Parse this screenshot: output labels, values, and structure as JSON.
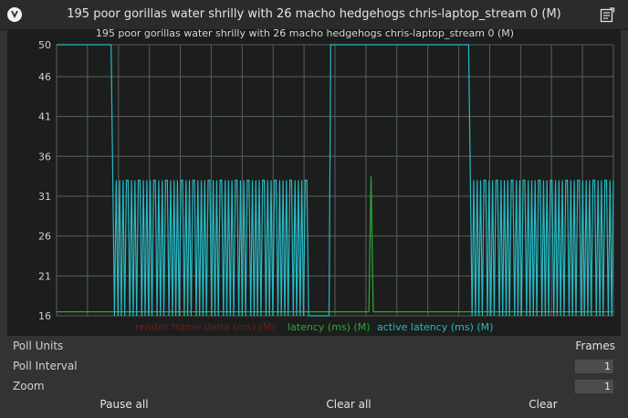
{
  "window": {
    "title": "195 poor gorillas water shrilly with 26 macho hedgehogs chris-laptop_stream 0 (M)"
  },
  "icons": {
    "app": "app-logo-icon",
    "notes": "notes-icon"
  },
  "chart_data": {
    "type": "line",
    "title": "195 poor gorillas water shrilly with 26 macho hedgehogs chris-laptop_stream 0 (M)",
    "ylim": [
      16,
      50
    ],
    "yticks": [
      16,
      21,
      26,
      31,
      36,
      41,
      46,
      50
    ],
    "grid": true,
    "legend_placement": "bottom",
    "series": [
      {
        "name": "render frame delta (ms) (M)",
        "color": "#6e1d1d",
        "values": []
      },
      {
        "name": "latency (ms) (M)",
        "color": "#2fa82f",
        "values": [
          16.5,
          16.5,
          16.5,
          16.5,
          16.5,
          16.5,
          16.5,
          16.5,
          16.5,
          16.5,
          16.5,
          16.5,
          16.5,
          16.5,
          16.5,
          16.5,
          16.5,
          16.5,
          16.5,
          16.5,
          16.5,
          16.5,
          16.5,
          16.5,
          16.5,
          16.5,
          16.5,
          16.5,
          16.5,
          16.5,
          16.5,
          16.5,
          16.5,
          16.5,
          16.5,
          16.5,
          16.5,
          16.5,
          16.5,
          16.5,
          16.5,
          16.5,
          16.5,
          16.5,
          16.5,
          16.5,
          16.5,
          16.5,
          16.5,
          16.5,
          16.5,
          16.5,
          16.5,
          16.5,
          16.5,
          16.5,
          16.5,
          16.5,
          16.5,
          16.5,
          16.5,
          16.5,
          16.5,
          16.5,
          16.5,
          16.5,
          16.5,
          16.5,
          16.5,
          16.5,
          16.5,
          16.5,
          16.5,
          16.5,
          16.5,
          16.5,
          16.5,
          16.5,
          16.5,
          16.5,
          16.5,
          16.5,
          16.5,
          16.5,
          16.5,
          16.5,
          16.5,
          16.5,
          16.5,
          16.5,
          16.5,
          16.5,
          16.5,
          16.5,
          16.5,
          16.5,
          16.5,
          16.5,
          16.5,
          16.5,
          16.5,
          16.5,
          16.5,
          16.5,
          16.5,
          16.5,
          16.5,
          16.5,
          16.5,
          16.5,
          16.5,
          16.5,
          16.5,
          16.5,
          16.5,
          16.5,
          16.5,
          16.5,
          16.5,
          16.5,
          16.5,
          16.5,
          16.5,
          16.5,
          16.5,
          16.5,
          16.5,
          16.5,
          16.5,
          16.5,
          16.5,
          16.5,
          16.5,
          16.5,
          16.5,
          16.5,
          16.5,
          16.5,
          16.5,
          16.5,
          16.5,
          16.5,
          16.5,
          16.5,
          33.5,
          16.5,
          16.5,
          16.5,
          16.5,
          16.5,
          16.5,
          16.5,
          16.5,
          16.5,
          16.5,
          16.5,
          16.5,
          16.5,
          16.5,
          16.5,
          16.5,
          16.5,
          16.5,
          16.5,
          16.5,
          16.5,
          16.5,
          16.5,
          16.5,
          16.5,
          16.5,
          16.5,
          16.5,
          16.5,
          16.5,
          16.5,
          16.5,
          16.5,
          16.5,
          16.5,
          16.5,
          16.5,
          16.5,
          16.5,
          16.5,
          16.5,
          16.5,
          16.5,
          16.5,
          16.5,
          16.5,
          16.5,
          16.5,
          16.5,
          16.5,
          16.5,
          16.5,
          16.5,
          16.5,
          16.5,
          16.5,
          16.5,
          16.5,
          16.5,
          16.5,
          16.5,
          16.5,
          16.5,
          16.5,
          16.5,
          16.5,
          16.5,
          16.5,
          16.5,
          16.5,
          16.5,
          16.5,
          16.5,
          16.5,
          16.5,
          16.5,
          16.5,
          16.5,
          16.5,
          16.5,
          16.5,
          16.5,
          16.5,
          16.5,
          16.5,
          16.5,
          16.5,
          16.5,
          16.5,
          16.5,
          16.5,
          16.5,
          16.5,
          16.5,
          16.5,
          16.5,
          16.5,
          16.5,
          16.5,
          16.5,
          16.5,
          16.5,
          16.5,
          16.5,
          16.5,
          16.5,
          16.5,
          16.5,
          16.5,
          16.5,
          16.5
        ]
      },
      {
        "name": "active latency (ms) (M)",
        "color": "#29b9c4",
        "values": [
          50,
          50,
          50,
          50,
          50,
          50,
          50,
          50,
          50,
          50,
          50,
          50,
          50,
          50,
          50,
          50,
          50,
          50,
          50,
          50,
          50,
          50,
          50,
          50,
          50,
          50,
          50,
          50,
          50,
          50,
          50,
          50,
          50,
          33,
          16,
          33,
          16,
          33,
          16,
          33,
          16,
          33,
          33,
          16,
          33,
          16,
          33,
          16,
          33,
          33,
          16,
          33,
          16,
          33,
          16,
          33,
          16,
          33,
          33,
          16,
          33,
          16,
          33,
          16,
          33,
          33,
          16,
          33,
          16,
          33,
          16,
          33,
          16,
          33,
          33,
          16,
          33,
          16,
          33,
          16,
          33,
          33,
          16,
          33,
          16,
          33,
          16,
          33,
          16,
          33,
          33,
          16,
          33,
          16,
          33,
          16,
          33,
          33,
          16,
          33,
          16,
          33,
          16,
          33,
          16,
          33,
          33,
          16,
          33,
          16,
          33,
          16,
          33,
          33,
          16,
          33,
          16,
          33,
          16,
          33,
          16,
          33,
          33,
          16,
          33,
          16,
          33,
          16,
          33,
          33,
          16,
          33,
          16,
          33,
          16,
          33,
          16,
          33,
          33,
          16,
          33,
          16,
          33,
          16,
          33,
          16,
          33,
          33,
          16,
          16,
          16,
          16,
          16,
          16,
          16,
          16,
          16,
          16,
          16,
          16,
          16,
          50,
          50,
          50,
          50,
          50,
          50,
          50,
          50,
          50,
          50,
          50,
          50,
          50,
          50,
          50,
          50,
          50,
          50,
          50,
          50,
          50,
          50,
          50,
          50,
          50,
          50,
          50,
          50,
          50,
          50,
          50,
          50,
          50,
          50,
          50,
          50,
          50,
          50,
          50,
          50,
          50,
          50,
          50,
          50,
          50,
          50,
          50,
          50,
          50,
          50,
          50,
          50,
          50,
          50,
          50,
          50,
          50,
          50,
          50,
          50,
          50,
          50,
          50,
          50,
          50,
          50,
          50,
          50,
          50,
          50,
          50,
          50,
          50,
          50,
          50,
          50,
          50,
          50,
          50,
          50,
          50,
          50,
          33,
          16,
          33,
          16,
          33,
          16,
          33,
          16,
          33,
          33,
          16,
          33,
          16,
          33,
          16,
          33,
          33,
          16,
          33,
          16,
          33,
          16,
          33,
          16,
          33,
          33,
          16,
          33,
          16,
          33,
          16,
          33,
          33,
          16,
          33,
          16,
          33,
          16,
          33,
          16,
          33,
          33,
          16,
          33,
          16,
          33,
          16,
          33,
          33,
          16,
          33,
          16,
          33,
          16,
          33,
          16,
          33,
          33,
          16,
          33,
          16,
          33,
          16,
          33,
          33,
          16,
          33,
          16,
          33,
          16,
          33,
          16,
          33,
          33,
          16,
          33,
          16,
          33,
          16,
          33,
          33,
          16,
          33,
          16,
          33
        ]
      }
    ]
  },
  "controls": {
    "poll_units": {
      "label": "Poll Units",
      "value": "Frames"
    },
    "poll_interval": {
      "label": "Poll Interval",
      "value": "1"
    },
    "zoom": {
      "label": "Zoom",
      "value": "1"
    }
  },
  "buttons": {
    "pause_all": "Pause all",
    "clear_all": "Clear all",
    "clear": "Clear"
  }
}
